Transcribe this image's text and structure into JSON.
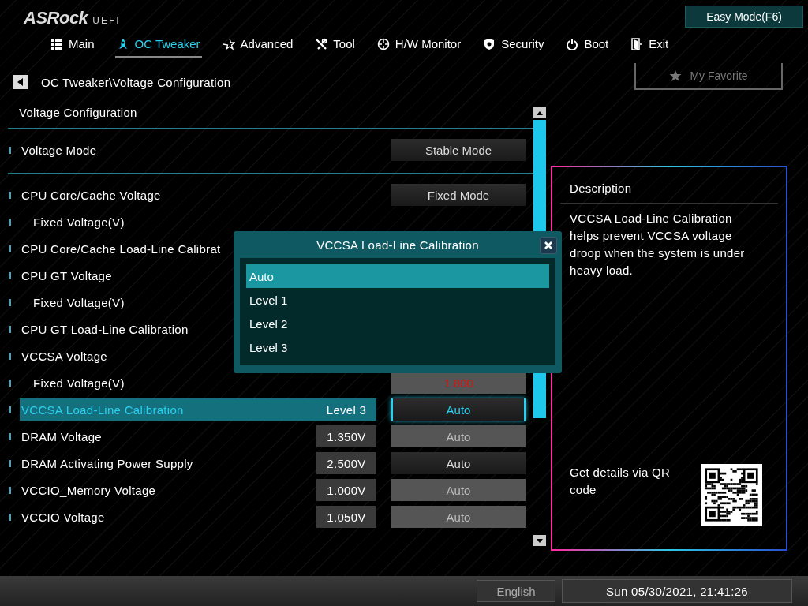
{
  "header": {
    "logo": "ASRock",
    "logo_suffix": "UEFI",
    "mode_button": "Easy Mode(F6)"
  },
  "tabs": [
    {
      "label": "Main",
      "selected": false
    },
    {
      "label": "OC Tweaker",
      "selected": true
    },
    {
      "label": "Advanced",
      "selected": false
    },
    {
      "label": "Tool",
      "selected": false
    },
    {
      "label": "H/W Monitor",
      "selected": false
    },
    {
      "label": "Security",
      "selected": false
    },
    {
      "label": "Boot",
      "selected": false
    },
    {
      "label": "Exit",
      "selected": false
    }
  ],
  "breadcrumb": {
    "path": "OC Tweaker\\Voltage Configuration",
    "favorite": "My Favorite"
  },
  "list": {
    "title": "Voltage Configuration",
    "sections": [
      {
        "items": [
          {
            "label": "Voltage Mode",
            "selected": false,
            "option": "Stable Mode",
            "kind": "dark"
          }
        ]
      },
      {
        "items": [
          {
            "label": "CPU Core/Cache Voltage",
            "selected": false,
            "option": "Fixed Mode",
            "kind": "dark",
            "children": [
              {
                "label": "Fixed Voltage(V)",
                "selected": false
              }
            ]
          },
          {
            "label": "CPU Core/Cache Load-Line Calibrat",
            "selected": false
          },
          {
            "label": "CPU GT Voltage",
            "selected": false,
            "children": [
              {
                "label": "Fixed Voltage(V)",
                "selected": false
              }
            ]
          },
          {
            "label": "CPU GT Load-Line Calibration",
            "selected": false
          },
          {
            "label": "VCCSA Voltage",
            "selected": false,
            "children": [
              {
                "label": "Fixed Voltage(V)",
                "selected": false,
                "option": "1.800",
                "kind": "warning"
              }
            ]
          },
          {
            "label": "VCCSA Load-Line Calibration",
            "selected": true,
            "value": "Level 3",
            "option": "Auto",
            "kind": "dark"
          },
          {
            "label": "DRAM Voltage",
            "selected": false,
            "value": "1.350V",
            "option": "Auto",
            "kind": "dim"
          },
          {
            "label": "DRAM Activating Power Supply",
            "selected": false,
            "value": "2.500V",
            "option": "Auto",
            "kind": "dark"
          },
          {
            "label": "VCCIO_Memory Voltage",
            "selected": false,
            "value": "1.000V",
            "option": "Auto",
            "kind": "dim"
          },
          {
            "label": "VCCIO Voltage",
            "selected": false,
            "value": "1.050V",
            "option": "Auto",
            "kind": "dim"
          }
        ]
      }
    ]
  },
  "description": {
    "title": "Description",
    "text": "VCCSA Load-Line Calibration helps prevent VCCSA voltage droop when the system is under heavy load.",
    "qr_caption": "Get details via QR code"
  },
  "modal": {
    "title": "VCCSA Load-Line Calibration",
    "options": [
      {
        "label": "Auto",
        "selected": true
      },
      {
        "label": "Level 1",
        "selected": false
      },
      {
        "label": "Level 2",
        "selected": false
      },
      {
        "label": "Level 3",
        "selected": false
      }
    ]
  },
  "footer": {
    "language": "English",
    "datetime": "Sun 05/30/2021, 21:41:26"
  }
}
